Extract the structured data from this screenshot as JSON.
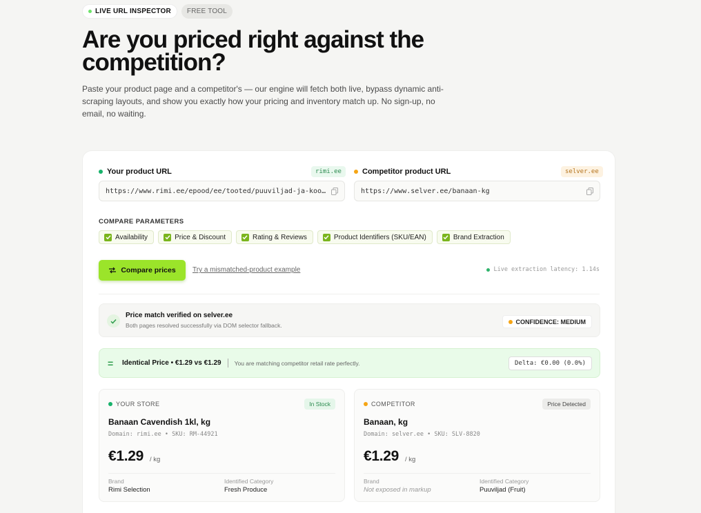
{
  "hero": {
    "live_tag": "LIVE URL INSPECTOR",
    "free_tag": "FREE TOOL",
    "title_line1": "Are you priced right against the",
    "title_line2": "competition?",
    "lead": "Paste your product page and a competitor's — our engine will fetch both live, bypass dynamic anti-scraping layouts, and show you exactly how your pricing and inventory match up. No sign-up, no email, no waiting."
  },
  "form": {
    "your_label": "Your product URL",
    "your_domain": "rimi.ee",
    "your_url": "https://www.rimi.ee/epood/ee/tooted/puuviljad-ja-koogiviljad/banaan-cavendish",
    "comp_label": "Competitor product URL",
    "comp_domain": "selver.ee",
    "comp_url": "https://www.selver.ee/banaan-kg"
  },
  "params": {
    "title": "COMPARE PARAMETERS",
    "items": [
      {
        "label": "Availability",
        "checked": true
      },
      {
        "label": "Price & Discount",
        "checked": true
      },
      {
        "label": "Rating & Reviews",
        "checked": true
      },
      {
        "label": "Product Identifiers (SKU/EAN)",
        "checked": true
      },
      {
        "label": "Brand Extraction",
        "checked": true
      }
    ]
  },
  "actions": {
    "compare_label": "Compare prices",
    "mismatch_link": "Try a mismatched-product example",
    "latency": "Live extraction latency: 1.14s"
  },
  "verified": {
    "title": "Price match verified on selver.ee",
    "subtitle": "Both pages resolved successfully via DOM selector fallback.",
    "confidence": "CONFIDENCE: MEDIUM"
  },
  "identical": {
    "title": "Identical Price • €1.29 vs €1.29",
    "subtitle": "You are matching competitor retail rate perfectly.",
    "delta": "Delta: €0.00 (0.0%)"
  },
  "your_store": {
    "kind": "YOUR STORE",
    "badge": "In Stock",
    "name": "Banaan Cavendish 1kl, kg",
    "meta": "Domain: rimi.ee • SKU: RM-44921",
    "price": "€1.29",
    "unit": "/ kg",
    "brand_key": "Brand",
    "brand_val": "Rimi Selection",
    "cat_key": "Identified Category",
    "cat_val": "Fresh Produce"
  },
  "competitor": {
    "kind": "COMPETITOR",
    "badge": "Price Detected",
    "name": "Banaan, kg",
    "meta": "Domain: selver.ee • SKU: SLV-8820",
    "price": "€1.29",
    "unit": "/ kg",
    "brand_key": "Brand",
    "brand_val": "Not exposed in markup",
    "cat_key": "Identified Category",
    "cat_val": "Puuviljad (Fruit)"
  },
  "colors": {
    "accent_green": "#9be42a",
    "your_dot": "#18b26b",
    "comp_dot": "#f5a515"
  }
}
